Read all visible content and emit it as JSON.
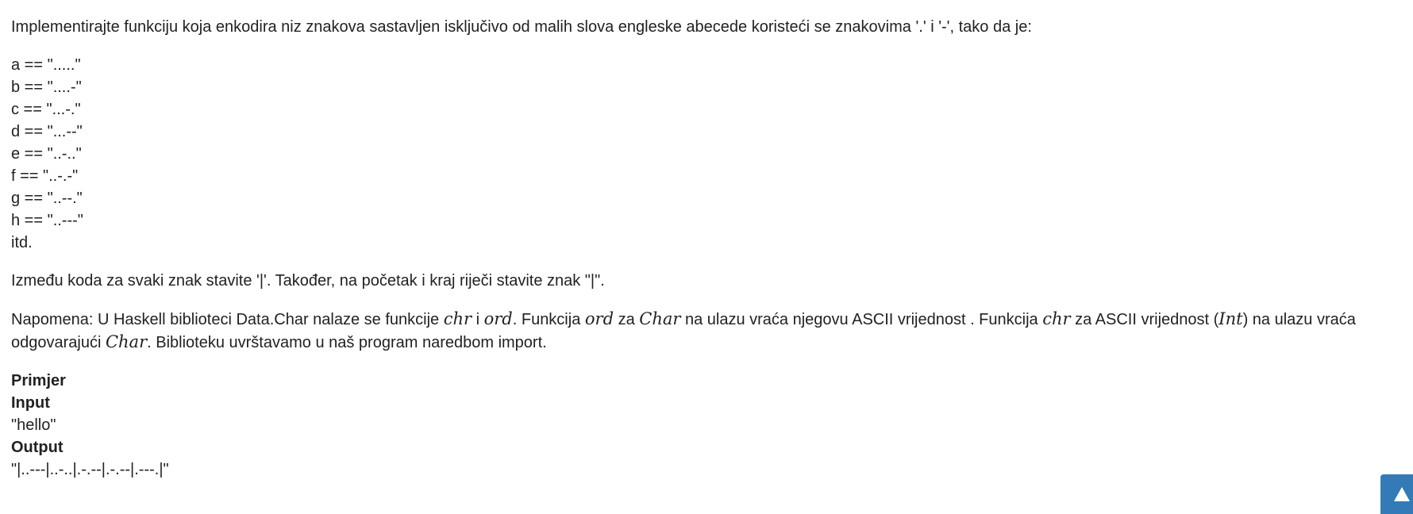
{
  "intro": "Implementirajte funkciju koja enkodira niz znakova sastavljen isključivo od malih slova engleske abecede koristeći se znakovima '.' i '-', tako da je:",
  "codes": [
    "a == \".....\"",
    "b == \"....-\"",
    "c == \"...-.\"",
    "d == \"...--\"",
    "e == \"..-..\"",
    "f == \"..-.-\"",
    "g == \"..--.\"",
    "h == \"..---\"",
    "itd."
  ],
  "separator_note": "Između koda za svaki znak stavite '|'. Također, na početak i kraj riječi stavite znak \"|\".",
  "note": {
    "t1": "Napomena: U Haskell biblioteci Data.Char nalaze se funkcije ",
    "m1": "chr",
    "t2": " i ",
    "m2": "ord",
    "t3": ". Funkcija ",
    "m3": "ord",
    "t4": " za ",
    "m4": "Char",
    "t5": " na ulazu vraća njegovu ASCII vrijednost . Funkcija ",
    "m5": "chr",
    "t6": " za ASCII vrijednost (",
    "m6": "Int",
    "t7": ") na ulazu vraća odgovarajući ",
    "m7": "Char",
    "t8": ". Biblioteku uvrštavamo u naš program naredbom import."
  },
  "example": {
    "heading": "Primjer",
    "input_label": "Input",
    "input_value": "\"hello\"",
    "output_label": "Output",
    "output_value": "\"|..---|..-..|.-.--|.-.--|.---.|\""
  },
  "scroll_top": {
    "icon": "arrow-up-icon",
    "color": "#337ab7"
  }
}
